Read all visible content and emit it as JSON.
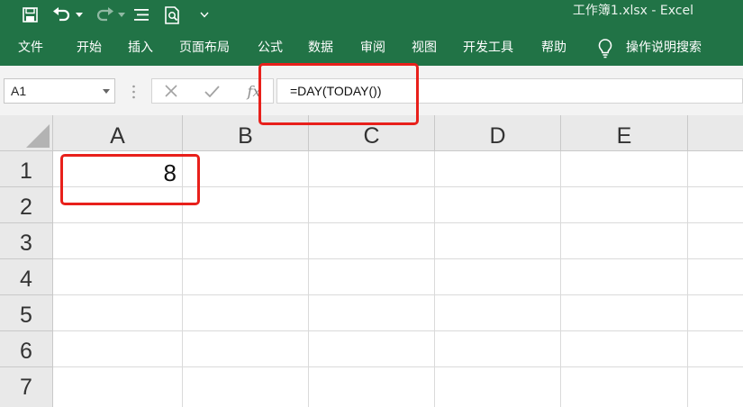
{
  "app": {
    "window_title": "工作簿1.xlsx  -  Excel",
    "accent_color": "#217346",
    "annotation_color": "#e8201b"
  },
  "quick_access": [
    {
      "name": "save",
      "icon": "save-icon"
    },
    {
      "name": "undo",
      "icon": "undo-icon"
    },
    {
      "name": "redo",
      "icon": "redo-icon"
    },
    {
      "name": "sort",
      "icon": "sort-icon"
    },
    {
      "name": "print-preview",
      "icon": "print-preview-icon"
    },
    {
      "name": "customize",
      "icon": "chevron-down-icon"
    }
  ],
  "ribbon": {
    "tabs": [
      "文件",
      "开始",
      "插入",
      "页面布局",
      "公式",
      "数据",
      "审阅",
      "视图",
      "开发工具",
      "帮助"
    ],
    "tell_me": {
      "icon": "lightbulb-icon",
      "label": "操作说明搜索"
    }
  },
  "formula_bar": {
    "name_box": "A1",
    "fx_label": "fx",
    "formula": "=DAY(TODAY())",
    "buttons": [
      {
        "name": "cancel",
        "icon": "close-icon"
      },
      {
        "name": "enter",
        "icon": "check-icon"
      },
      {
        "name": "insert-function",
        "icon": "fx-icon"
      }
    ]
  },
  "sheet": {
    "columns": [
      "A",
      "B",
      "C",
      "D",
      "E"
    ],
    "rows": [
      "1",
      "2",
      "3",
      "4",
      "5",
      "6",
      "7"
    ],
    "cells": {
      "A1": "8"
    }
  }
}
